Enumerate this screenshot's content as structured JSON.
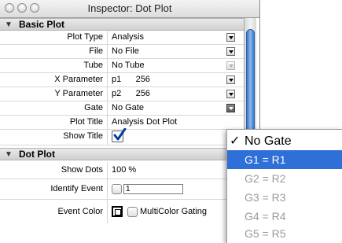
{
  "window": {
    "title": "Inspector: Dot Plot"
  },
  "sections": {
    "basic": "Basic Plot",
    "dot": "Dot Plot"
  },
  "basic_rows": {
    "plot_type": {
      "label": "Plot Type",
      "value": "Analysis"
    },
    "file": {
      "label": "File",
      "value": "No File"
    },
    "tube": {
      "label": "Tube",
      "value": "No Tube"
    },
    "x_param": {
      "label": "X Parameter",
      "value": "p1      256"
    },
    "y_param": {
      "label": "Y Parameter",
      "value": "p2      256"
    },
    "gate": {
      "label": "Gate",
      "value": "No Gate"
    },
    "plot_title": {
      "label": "Plot Title",
      "value": "Analysis Dot Plot"
    },
    "show_title": {
      "label": "Show Title",
      "checked": true
    }
  },
  "dot_rows": {
    "show_dots": {
      "label": "Show Dots",
      "value": "100 %"
    },
    "identify_event": {
      "label": "Identify Event",
      "value": "1"
    },
    "event_color": {
      "label": "Event Color",
      "multicolor_label": "MultiColor Gating"
    }
  },
  "gate_menu": {
    "items": [
      {
        "label": "No Gate",
        "checked": true,
        "state": "normal"
      },
      {
        "label": "G1 = R1",
        "state": "highlighted"
      },
      {
        "label": "G2 = R2",
        "state": "disabled"
      },
      {
        "label": "G3 = R3",
        "state": "disabled"
      },
      {
        "label": "G4 = R4",
        "state": "disabled"
      },
      {
        "label": "G5 = R5",
        "state": "disabled"
      }
    ],
    "check_glyph": "✓"
  },
  "colors": {
    "selection": "#2f6fd8",
    "scroll_thumb": "#5b94e0"
  },
  "icons": [
    "close-light",
    "minimize-light",
    "zoom-light",
    "disclosure-triangle",
    "popup-arrow",
    "checkmark"
  ]
}
